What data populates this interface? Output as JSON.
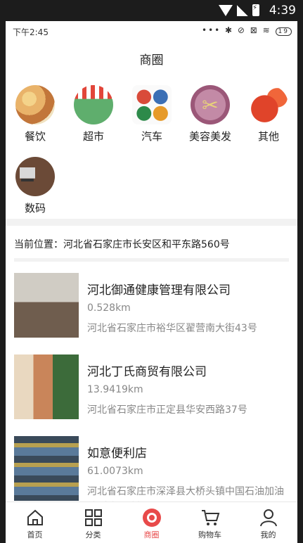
{
  "system_status": {
    "time": "4:39"
  },
  "app_status": {
    "time": "下午2:45",
    "icons": "••• ✱ ⊘ ⊠ ≋",
    "battery": "19"
  },
  "page_title": "商圈",
  "categories": [
    {
      "label": "餐饮",
      "icon": "food-icon",
      "color": "#e9b36a"
    },
    {
      "label": "超市",
      "icon": "supermarket-icon",
      "color": "#5fae6d"
    },
    {
      "label": "汽车",
      "icon": "car-icon",
      "color": "#d94b3a"
    },
    {
      "label": "美容美发",
      "icon": "scissors-icon",
      "color": "#b16c8e"
    },
    {
      "label": "其他",
      "icon": "lantern-icon",
      "color": "#e0442a"
    },
    {
      "label": "数码",
      "icon": "computer-icon",
      "color": "#6b4a37"
    }
  ],
  "location": "当前位置：河北省石家庄市长安区和平东路560号",
  "stores": [
    {
      "name": "河北御通健康管理有限公司",
      "distance": "0.528km",
      "address": "河北省石家庄市裕华区翟营南大街43号",
      "thumb_color": "#8a7a6a"
    },
    {
      "name": "河北丁氏商贸有限公司",
      "distance": "13.9419km",
      "address": "河北省石家庄市正定县华安西路37号",
      "thumb_color": "#c9a070"
    },
    {
      "name": "如意便利店",
      "distance": "61.0073km",
      "address": "河北省石家庄市深泽县大桥头镇中国石油加油站(大桥头村)",
      "thumb_color": "#4a6a8a"
    }
  ],
  "tabs": [
    {
      "label": "首页",
      "icon": "home-icon"
    },
    {
      "label": "分类",
      "icon": "grid-icon"
    },
    {
      "label": "商圈",
      "icon": "circle-icon",
      "active": true
    },
    {
      "label": "购物车",
      "icon": "cart-icon"
    },
    {
      "label": "我的",
      "icon": "user-icon"
    }
  ],
  "colors": {
    "accent": "#e84a4a"
  }
}
